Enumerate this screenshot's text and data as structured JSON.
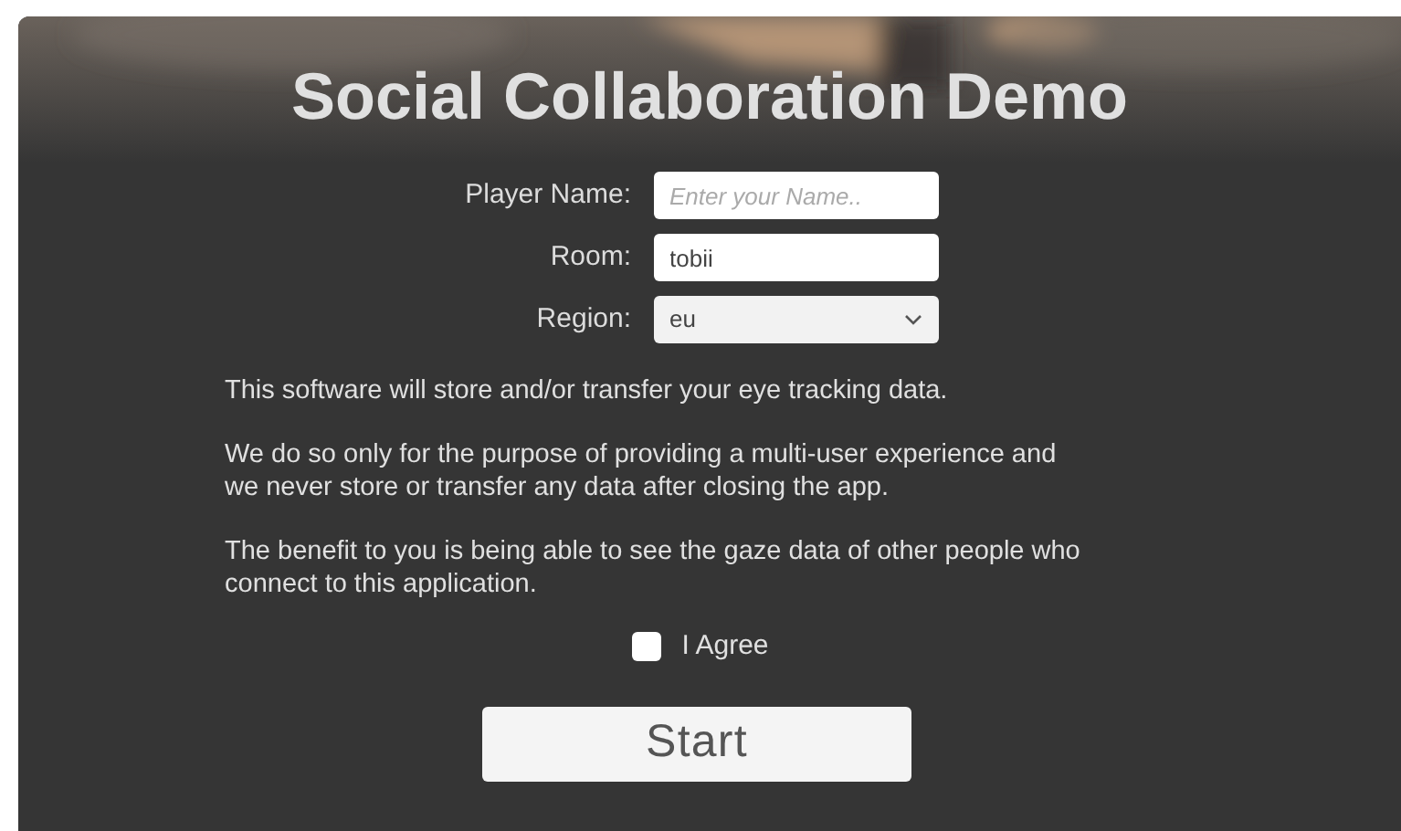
{
  "title": "Social Collaboration Demo",
  "fields": [
    {
      "kind": "text",
      "label": "Player Name:",
      "placeholder": "Enter your Name.."
    },
    {
      "kind": "text",
      "label": "Room:",
      "value": "tobii"
    },
    {
      "kind": "select",
      "label": "Region:",
      "value": "eu"
    }
  ],
  "paragraphs": [
    "This software will store and/or transfer your eye tracking data.",
    "We do so only for the purpose of providing a multi-user experience and we never store or transfer any data after closing the app.",
    "The benefit to you is being able to see the gaze data of other people who connect to this application."
  ],
  "agree": {
    "label": "I Agree",
    "checked": false
  },
  "button": "Start"
}
